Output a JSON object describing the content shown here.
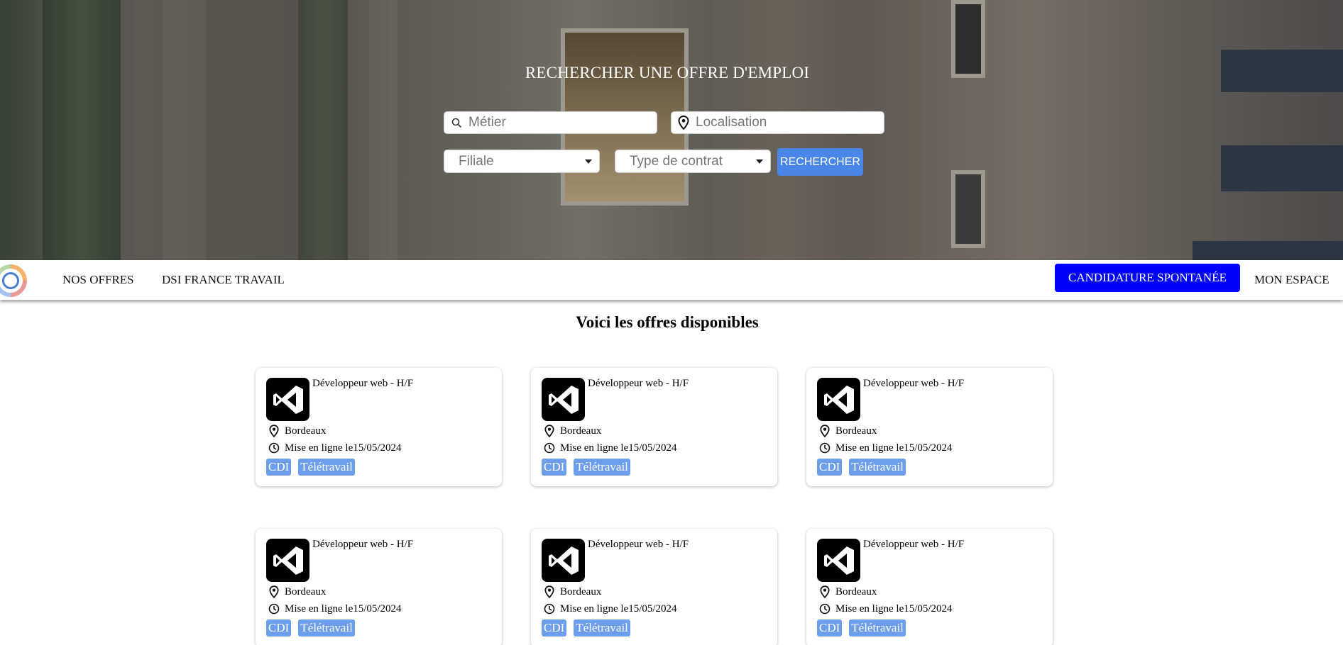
{
  "hero": {
    "title": "RECHERCHER UNE OFFRE D'EMPLOI",
    "metier_placeholder": "Métier",
    "localisation_placeholder": "Localisation",
    "filiale_label": "Filiale",
    "contrat_label": "Type de contrat",
    "search_label": "RECHERCHER"
  },
  "nav": {
    "links": [
      "NOS OFFRES",
      "DSI FRANCE TRAVAIL"
    ],
    "cta_label": "CANDIDATURE SPONTANÉE",
    "account_label": "MON ESPACE"
  },
  "main": {
    "title": "Voici les offres disponibles",
    "offers": [
      {
        "title": "Développeur web - H/F",
        "location": "Bordeaux",
        "posted": "Mise en ligne le15/05/2024",
        "tags": [
          "CDI",
          "Télétravail"
        ]
      },
      {
        "title": "Développeur web - H/F",
        "location": "Bordeaux",
        "posted": "Mise en ligne le15/05/2024",
        "tags": [
          "CDI",
          "Télétravail"
        ]
      },
      {
        "title": "Développeur web - H/F",
        "location": "Bordeaux",
        "posted": "Mise en ligne le15/05/2024",
        "tags": [
          "CDI",
          "Télétravail"
        ]
      },
      {
        "title": "Développeur web - H/F",
        "location": "Bordeaux",
        "posted": "Mise en ligne le15/05/2024",
        "tags": [
          "CDI",
          "Télétravail"
        ]
      },
      {
        "title": "Développeur web - H/F",
        "location": "Bordeaux",
        "posted": "Mise en ligne le15/05/2024",
        "tags": [
          "CDI",
          "Télétravail"
        ]
      },
      {
        "title": "Développeur web - H/F",
        "location": "Bordeaux",
        "posted": "Mise en ligne le15/05/2024",
        "tags": [
          "CDI",
          "Télétravail"
        ]
      }
    ]
  },
  "colors": {
    "search_button": "#4a86e8",
    "cta": "#0000ff",
    "tag": "#6d9eeb"
  },
  "icons": {
    "search": "search-icon",
    "location": "map-pin-icon",
    "clock": "clock-icon",
    "app": "visual-studio-icon",
    "dropdown": "caret-down-icon"
  }
}
